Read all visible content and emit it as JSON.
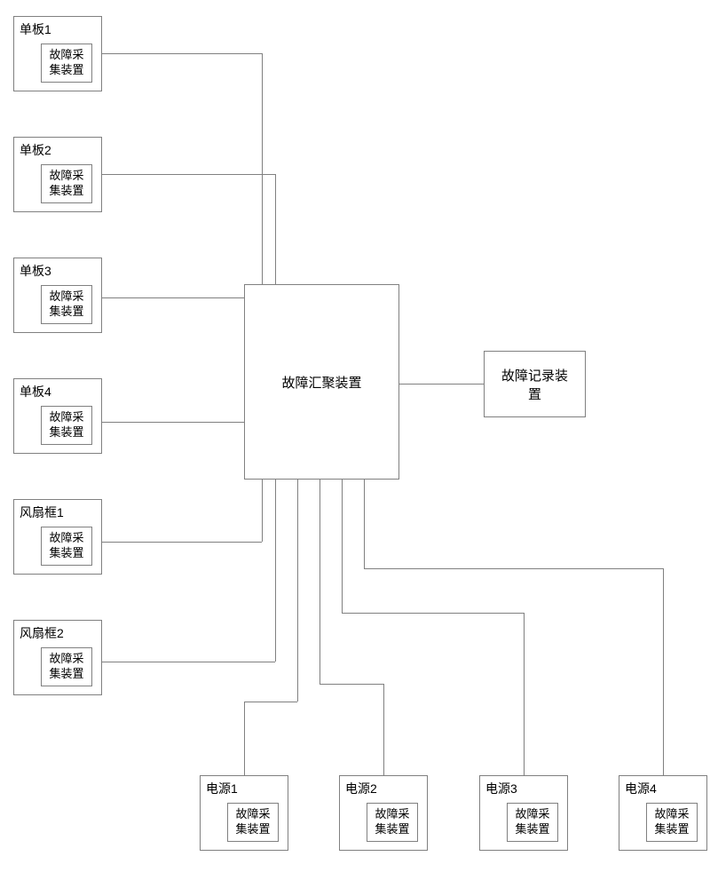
{
  "left_units": [
    {
      "title": "单板1",
      "inner": "故障采\n集装置"
    },
    {
      "title": "单板2",
      "inner": "故障采\n集装置"
    },
    {
      "title": "单板3",
      "inner": "故障采\n集装置"
    },
    {
      "title": "单板4",
      "inner": "故障采\n集装置"
    },
    {
      "title": "风扇框1",
      "inner": "故障采\n集装置"
    },
    {
      "title": "风扇框2",
      "inner": "故障采\n集装置"
    }
  ],
  "bottom_units": [
    {
      "title": "电源1",
      "inner": "故障采\n集装置"
    },
    {
      "title": "电源2",
      "inner": "故障采\n集装置"
    },
    {
      "title": "电源3",
      "inner": "故障采\n集装置"
    },
    {
      "title": "电源4",
      "inner": "故障采\n集装置"
    }
  ],
  "center": {
    "label": "故障汇聚装置"
  },
  "recorder": {
    "label": "故障记录装\n置"
  }
}
